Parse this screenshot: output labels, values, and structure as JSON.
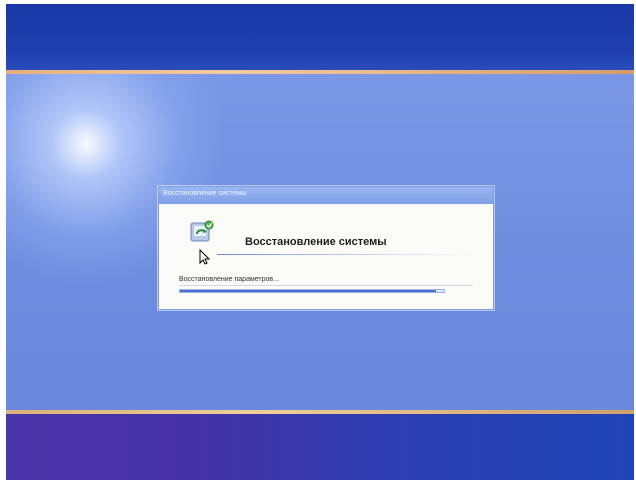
{
  "dialog": {
    "title": "Восстановление системы",
    "heading": "Восстановление системы",
    "status": "Восстановление параметров...",
    "progress": 0.97,
    "icon": "system-restore-icon"
  },
  "cursor": {
    "icon": "mouse-pointer-icon"
  },
  "colors": {
    "top_band": "#1f3fae",
    "desktop": "#6f8fe0",
    "bottom_band": "#4531a6",
    "progress_fill": "#3d62c8"
  }
}
